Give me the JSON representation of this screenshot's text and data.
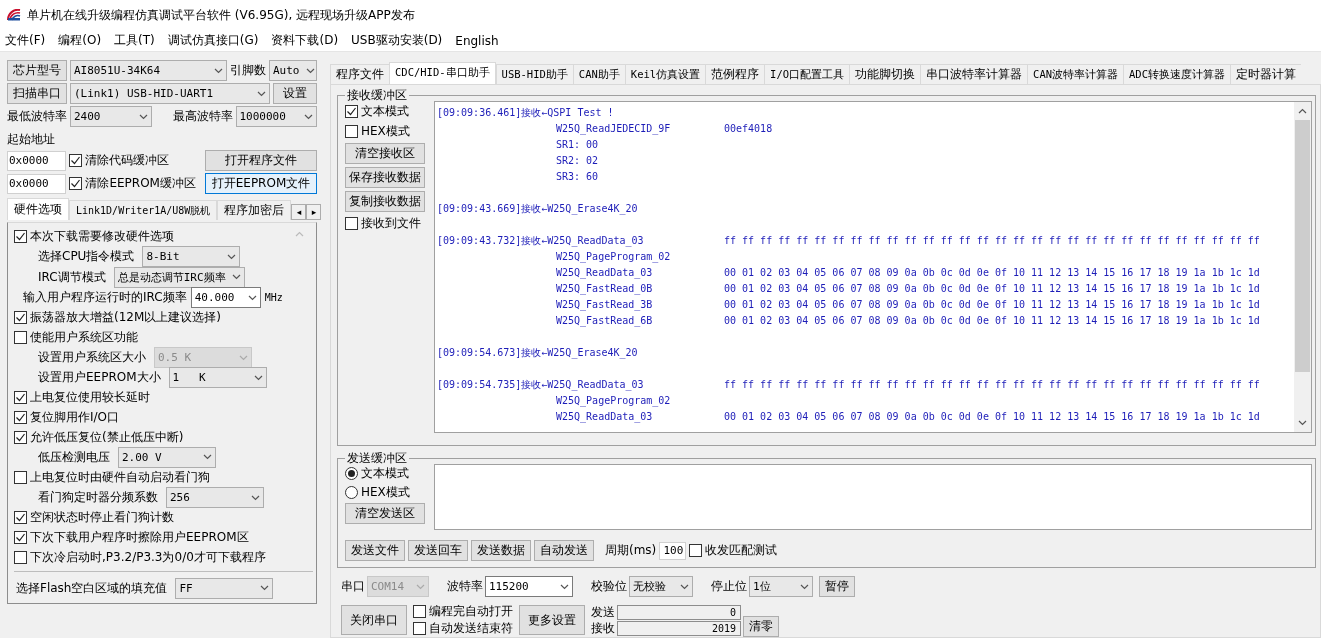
{
  "window": {
    "title": "单片机在线升级编程仿真调试平台软件 (V6.95G), 远程现场升级APP发布"
  },
  "menu": [
    "文件(F)",
    "编程(O)",
    "工具(T)",
    "调试仿真接口(G)",
    "资料下载(D)",
    "USB驱动安装(D)",
    "English"
  ],
  "left": {
    "chip": {
      "button": "芯片型号",
      "value": "AI8051U-34K64",
      "pins_label": "引脚数",
      "pins": "Auto"
    },
    "port": {
      "button": "扫描串口",
      "value": "(Link1) USB-HID-UART1",
      "settings": "设置"
    },
    "baud": {
      "min_label": "最低波特率",
      "min": "2400",
      "max_label": "最高波特率",
      "max": "1000000"
    },
    "start_label": "起始地址",
    "files": [
      {
        "address": "0x0000",
        "label": "清除代码缓冲区",
        "checked": true,
        "button": "打开程序文件",
        "focused": false
      },
      {
        "address": "0x0000",
        "label": "清除EEPROM缓冲区",
        "checked": true,
        "button": "打开EEPROM文件",
        "focused": true
      }
    ],
    "tabs": [
      {
        "label": "硬件选项",
        "selected": true
      },
      {
        "label": "Link1D/Writer1A/U8W脱机",
        "selected": false
      },
      {
        "label": "程序加密后",
        "selected": false
      }
    ],
    "tab_scroll": [
      "◂",
      "▸"
    ],
    "options": [
      {
        "kind": "check",
        "label": "本次下载需要修改硬件选项",
        "checked": true
      },
      {
        "kind": "select",
        "label": "选择CPU指令模式",
        "value": "8-Bit",
        "disabled": false
      },
      {
        "kind": "select",
        "label": "IRC调节模式",
        "value": "总是动态调节IRC频率",
        "disabled": false
      },
      {
        "kind": "combo",
        "label": "输入用户程序运行时的IRC频率",
        "value": "40.000",
        "unit": "MHz"
      },
      {
        "kind": "check",
        "label": "振荡器放大增益(12M以上建议选择)",
        "checked": true
      },
      {
        "kind": "check",
        "label": "使能用户系统区功能",
        "checked": false
      },
      {
        "kind": "select",
        "label": "设置用户系统区大小",
        "value": "0.5 K",
        "disabled": true
      },
      {
        "kind": "select",
        "label": "设置用户EEPROM大小",
        "value": "1   K",
        "disabled": false
      },
      {
        "kind": "check",
        "label": "上电复位使用较长延时",
        "checked": true
      },
      {
        "kind": "check",
        "label": "复位脚用作I/O口",
        "checked": true
      },
      {
        "kind": "check",
        "label": "允许低压复位(禁止低压中断)",
        "checked": true
      },
      {
        "kind": "select",
        "label": "低压检测电压",
        "value": "2.00 V",
        "disabled": false
      },
      {
        "kind": "check",
        "label": "上电复位时由硬件自动启动看门狗",
        "checked": false
      },
      {
        "kind": "select",
        "label": "看门狗定时器分频系数",
        "value": "256",
        "disabled": false
      },
      {
        "kind": "check",
        "label": "空闲状态时停止看门狗计数",
        "checked": true
      },
      {
        "kind": "check",
        "label": "下次下载用户程序时擦除用户EEPROM区",
        "checked": true
      },
      {
        "kind": "check",
        "label": "下次冷启动时,P3.2/P3.3为0/0才可下载程序",
        "checked": false
      }
    ],
    "fill": {
      "label": "选择Flash空白区域的填充值",
      "value": "FF",
      "disabled": false
    }
  },
  "right": {
    "tabs": [
      {
        "label": "程序文件",
        "selected": false
      },
      {
        "label": "CDC/HID-串口助手",
        "selected": true
      },
      {
        "label": "USB-HID助手",
        "selected": false
      },
      {
        "label": "CAN助手",
        "selected": false
      },
      {
        "label": "Keil仿真设置",
        "selected": false
      },
      {
        "label": "范例程序",
        "selected": false
      },
      {
        "label": "I/O口配置工具",
        "selected": false
      },
      {
        "label": "功能脚切换",
        "selected": false
      },
      {
        "label": "串口波特率计算器",
        "selected": false
      },
      {
        "label": "CAN波特率计算器",
        "selected": false
      },
      {
        "label": "ADC转换速度计算器",
        "selected": false
      },
      {
        "label": "定时器计算",
        "selected": false
      }
    ],
    "receive": {
      "title": "接收缓冲区",
      "controls": [
        {
          "kind": "check",
          "label": "文本模式",
          "checked": true
        },
        {
          "kind": "check",
          "label": "HEX模式",
          "checked": false
        },
        {
          "kind": "button",
          "label": "清空接收区"
        },
        {
          "kind": "button",
          "label": "保存接收数据"
        },
        {
          "kind": "button",
          "label": "复制接收数据"
        },
        {
          "kind": "check",
          "label": "接收到文件",
          "checked": false
        }
      ],
      "log": [
        {
          "head": "[09:09:36.461]接收←QSPI Test !",
          "lines": [
            {
              "name": "W25Q_ReadJEDECID_9F",
              "data": "00ef4018"
            },
            {
              "name": "SR1: 00"
            },
            {
              "name": "SR2: 02"
            },
            {
              "name": "SR3: 60"
            }
          ]
        },
        {
          "head": "[09:09:43.669]接收←W25Q_Erase4K_20"
        },
        {
          "head": "[09:09:43.732]接收←W25Q_ReadData_03",
          "data": "ff ff ff ff ff ff ff ff ff ff ff ff ff ff ff ff ff ff ff ff ff ff ff ff ff ff ff ff ff ff",
          "lines": [
            {
              "name": "W25Q_PageProgram_02"
            },
            {
              "name": "W25Q_ReadData_03",
              "data": "00 01 02 03 04 05 06 07 08 09 0a 0b 0c 0d 0e 0f 10 11 12 13 14 15 16 17 18 19 1a 1b 1c 1d"
            },
            {
              "name": "W25Q_FastRead_0B",
              "data": "00 01 02 03 04 05 06 07 08 09 0a 0b 0c 0d 0e 0f 10 11 12 13 14 15 16 17 18 19 1a 1b 1c 1d"
            },
            {
              "name": "W25Q_FastRead_3B",
              "data": "00 01 02 03 04 05 06 07 08 09 0a 0b 0c 0d 0e 0f 10 11 12 13 14 15 16 17 18 19 1a 1b 1c 1d"
            },
            {
              "name": "W25Q_FastRead_6B",
              "data": "00 01 02 03 04 05 06 07 08 09 0a 0b 0c 0d 0e 0f 10 11 12 13 14 15 16 17 18 19 1a 1b 1c 1d"
            }
          ]
        },
        {
          "head": "[09:09:54.673]接收←W25Q_Erase4K_20"
        },
        {
          "head": "[09:09:54.735]接收←W25Q_ReadData_03",
          "data": "ff ff ff ff ff ff ff ff ff ff ff ff ff ff ff ff ff ff ff ff ff ff ff ff ff ff ff ff ff ff",
          "lines": [
            {
              "name": "W25Q_PageProgram_02"
            },
            {
              "name": "W25Q_ReadData_03",
              "data": "00 01 02 03 04 05 06 07 08 09 0a 0b 0c 0d 0e 0f 10 11 12 13 14 15 16 17 18 19 1a 1b 1c 1d"
            }
          ]
        }
      ]
    },
    "send": {
      "title": "发送缓冲区",
      "modes": [
        {
          "label": "文本模式",
          "selected": true
        },
        {
          "label": "HEX模式",
          "selected": false
        }
      ],
      "clear": "清空发送区",
      "buttons": [
        "发送文件",
        "发送回车",
        "发送数据",
        "自动发送"
      ],
      "period_label": "周期(ms)",
      "period": "100",
      "match": {
        "label": "收发匹配测试",
        "checked": false
      }
    },
    "port": {
      "selects": [
        {
          "label": "串口",
          "value": "COM14",
          "disabled": true
        },
        {
          "label": "波特率",
          "value": "115200",
          "disabled": false
        },
        {
          "label": "校验位",
          "value": "无校验",
          "disabled": false
        },
        {
          "label": "停止位",
          "value": "1位",
          "disabled": false
        }
      ],
      "pause": "暂停",
      "close": "关闭串口",
      "checks": [
        {
          "label": "编程完自动打开",
          "checked": false
        },
        {
          "label": "自动发送结束符",
          "checked": false
        }
      ],
      "more": "更多设置",
      "counters": [
        {
          "label": "发送",
          "value": "0"
        },
        {
          "label": "接收",
          "value": "2019"
        }
      ],
      "reset": "清零"
    }
  }
}
